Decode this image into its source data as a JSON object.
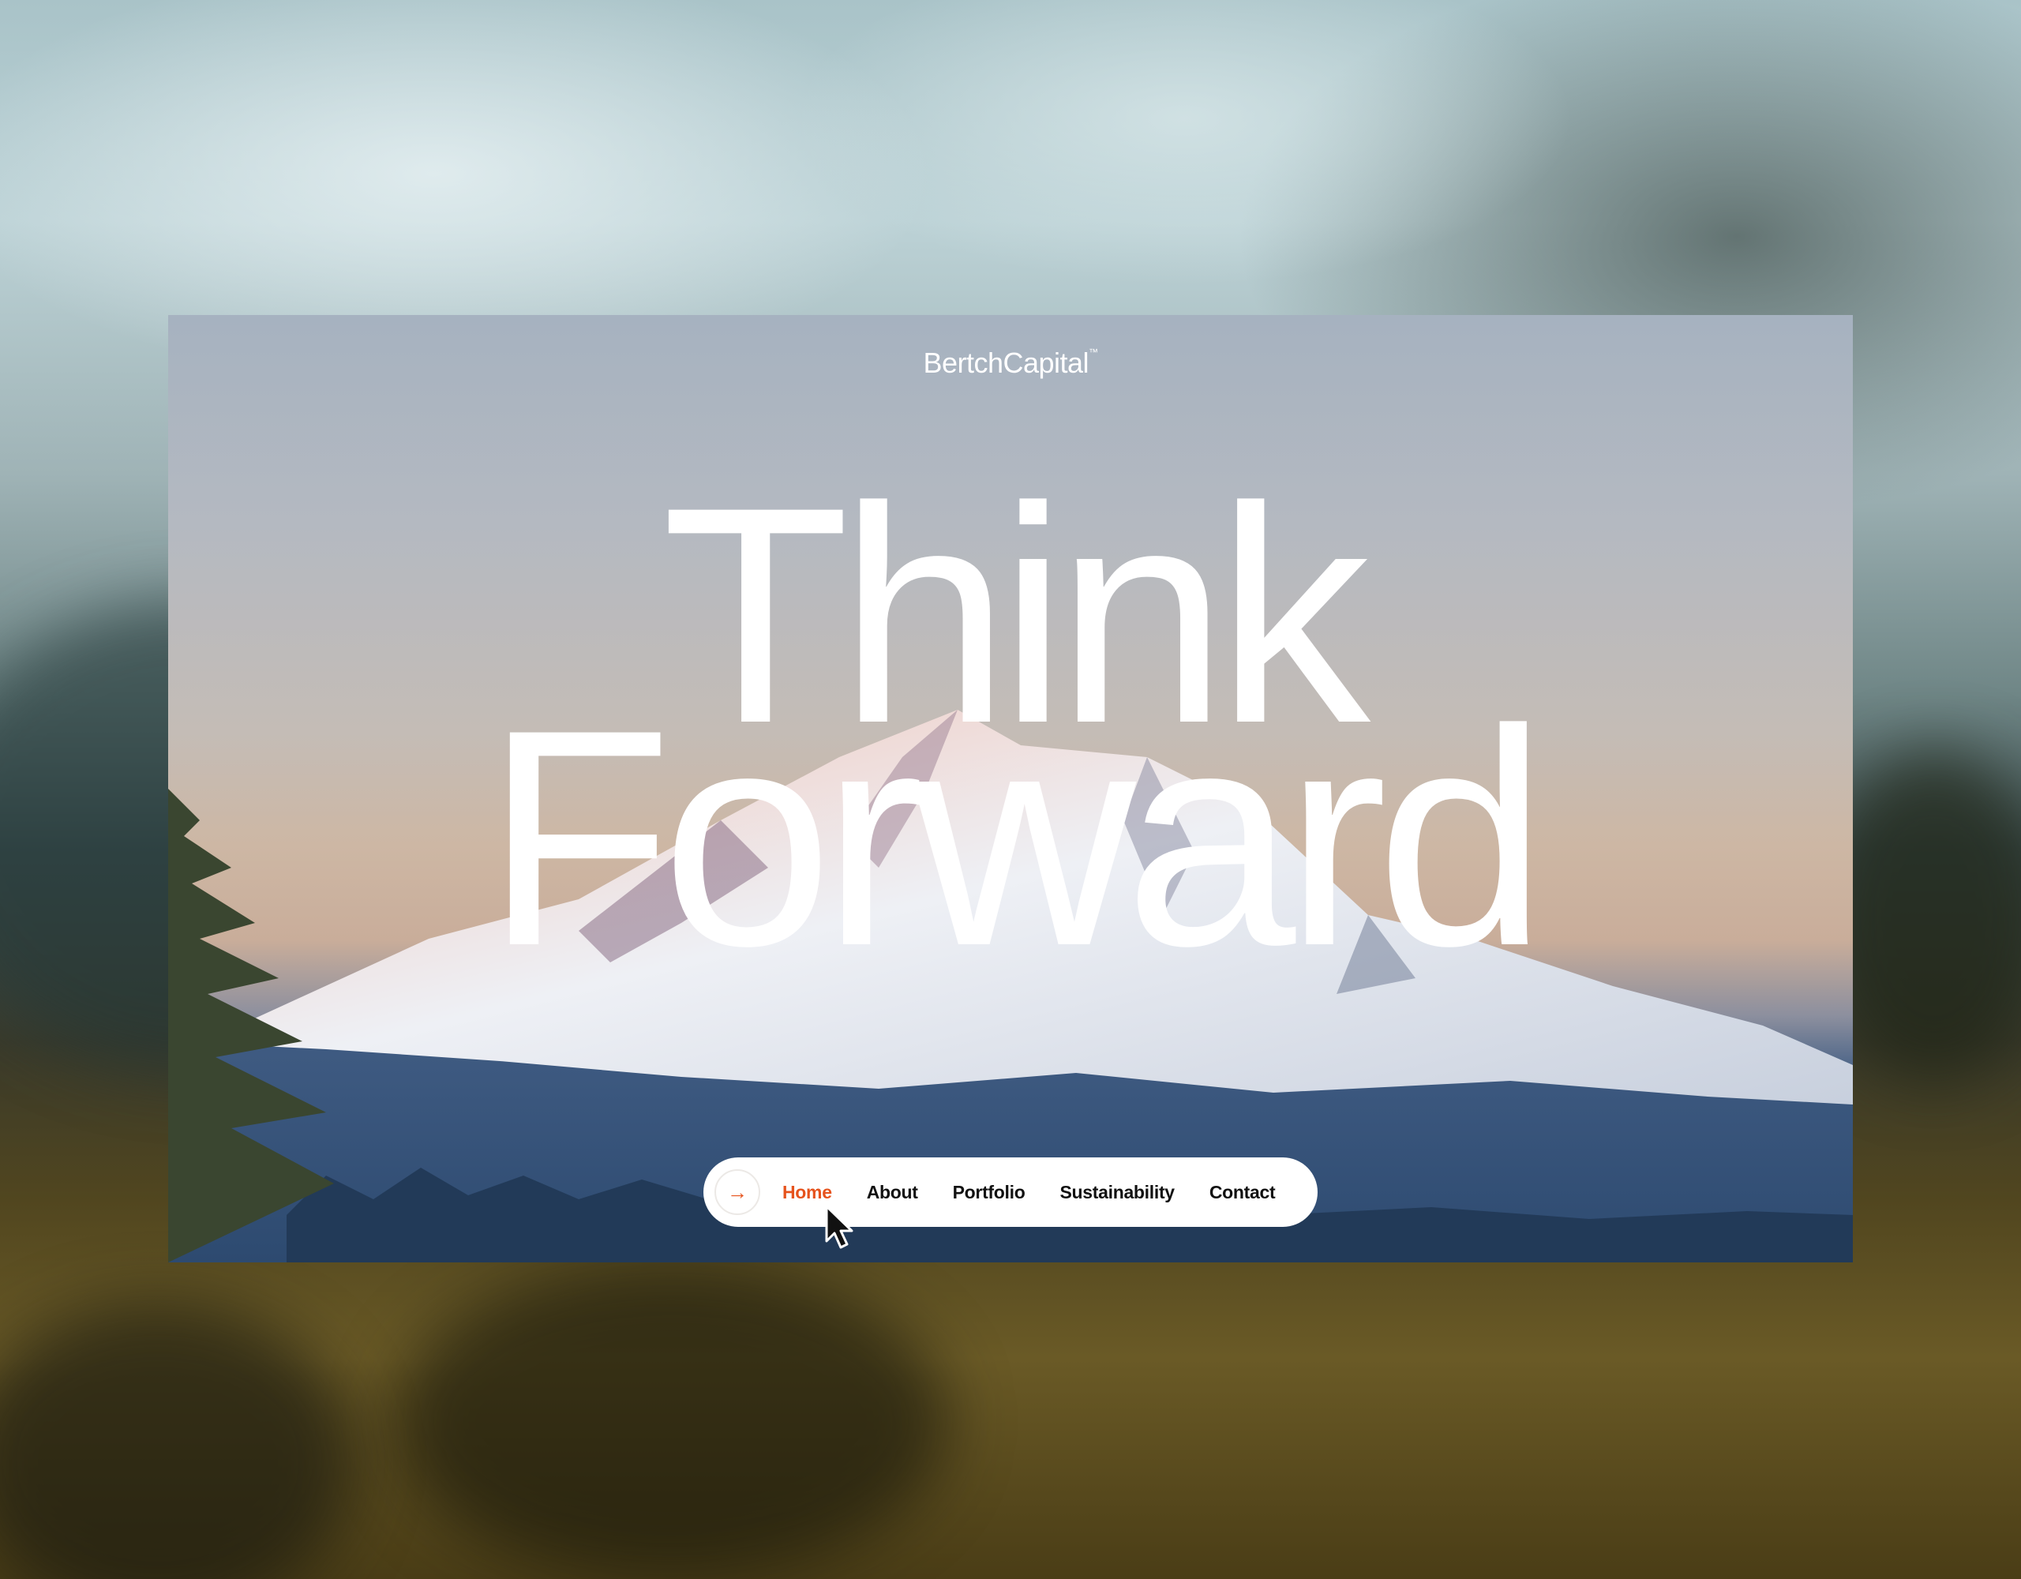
{
  "brand": {
    "name": "BertchCapital",
    "trademark": "™",
    "accent_color": "#e6531d"
  },
  "hero": {
    "line1": "Think",
    "line2": "Forward"
  },
  "nav": {
    "arrow_glyph": "→",
    "arrow_icon": "arrow-right-icon",
    "items": [
      {
        "label": "Home",
        "active": true
      },
      {
        "label": "About",
        "active": false
      },
      {
        "label": "Portfolio",
        "active": false
      },
      {
        "label": "Sustainability",
        "active": false
      },
      {
        "label": "Contact",
        "active": false
      }
    ]
  },
  "background": {
    "image": "snow-capped mountain at sunset with evergreen forest"
  }
}
